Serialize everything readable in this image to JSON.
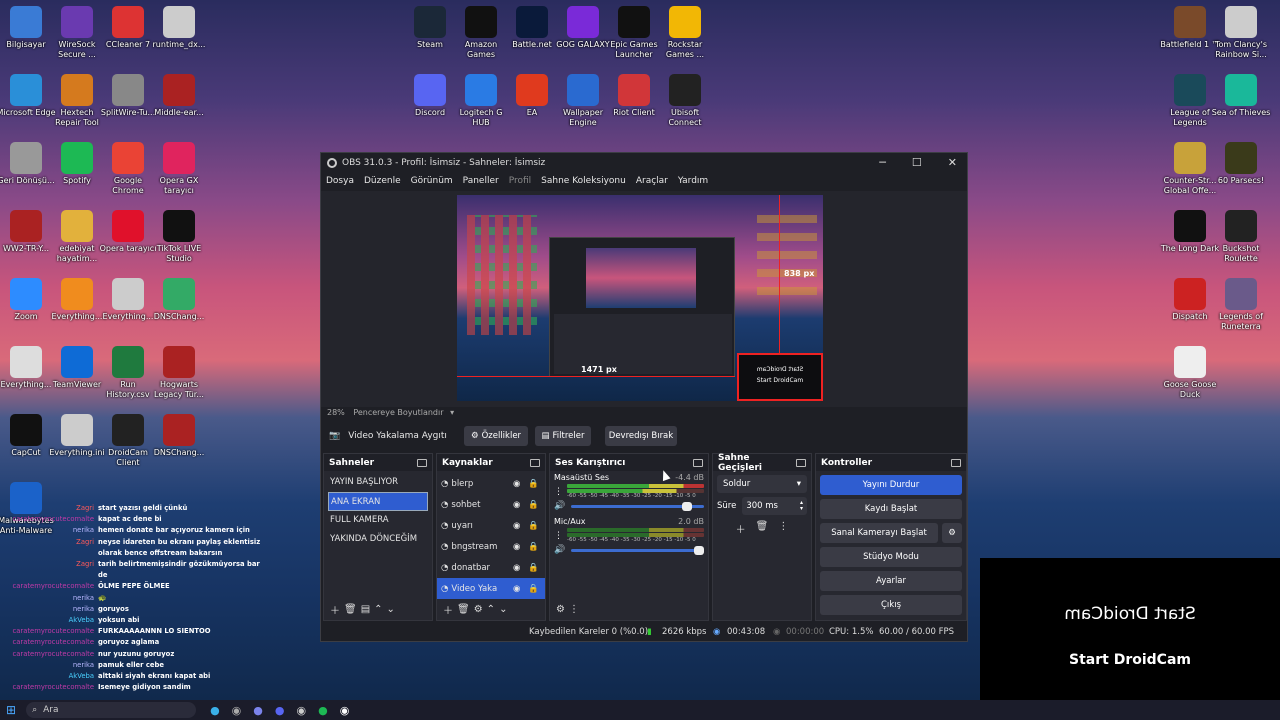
{
  "desktop_left": [
    {
      "label": "Bilgisayar",
      "color": "#3a7bd5"
    },
    {
      "label": "WireSock Secure ...",
      "color": "#6a3ab0"
    },
    {
      "label": "CCleaner 7",
      "color": "#d33"
    },
    {
      "label": "runtime_dx...",
      "color": "#ccc"
    },
    {
      "label": "Microsoft Edge",
      "color": "#2a8fd8"
    },
    {
      "label": "Hextech Repair Tool",
      "color": "#d57a1e"
    },
    {
      "label": "SplitWire-Tu...",
      "color": "#888"
    },
    {
      "label": "Middle-ear...",
      "color": "#a22"
    },
    {
      "label": "Geri Dönüşü...",
      "color": "#999"
    },
    {
      "label": "Spotify",
      "color": "#1db954"
    },
    {
      "label": "Google Chrome",
      "color": "#ea4335"
    },
    {
      "label": "Opera GX tarayıcı",
      "color": "#e0245e"
    },
    {
      "label": "WW2-TR-Y...",
      "color": "#a22"
    },
    {
      "label": "edebiyat hayatim...",
      "color": "#e2b13c"
    },
    {
      "label": "Opera tarayıcı",
      "color": "#e0112b"
    },
    {
      "label": "TikTok LIVE Studio",
      "color": "#111"
    },
    {
      "label": "Zoom",
      "color": "#2d8cff"
    },
    {
      "label": "Everything...",
      "color": "#f08c1e"
    },
    {
      "label": "Everything...",
      "color": "#ccc"
    },
    {
      "label": "DNSChang...",
      "color": "#3a6"
    },
    {
      "label": "Everything...",
      "color": "#ddd"
    },
    {
      "label": "TeamViewer",
      "color": "#0e6bd6"
    },
    {
      "label": "Run History.csv",
      "color": "#1f7a3e"
    },
    {
      "label": "Hogwarts Legacy Tür...",
      "color": "#a22"
    },
    {
      "label": "CapCut",
      "color": "#111"
    },
    {
      "label": "Everything.ini",
      "color": "#ccc"
    },
    {
      "label": "DroidCam Client",
      "color": "#222"
    },
    {
      "label": "DNSChang...",
      "color": "#a22"
    },
    {
      "label": "Malwarebytes Anti-Malware",
      "color": "#1b62c9"
    }
  ],
  "desktop_top": [
    {
      "label": "Steam",
      "color": "#1b2838"
    },
    {
      "label": "Amazon Games",
      "color": "#111"
    },
    {
      "label": "Battle.net",
      "color": "#0a1a3a"
    },
    {
      "label": "GOG GALAXY",
      "color": "#7a2ad8"
    },
    {
      "label": "Epic Games Launcher",
      "color": "#111"
    },
    {
      "label": "Rockstar Games ...",
      "color": "#f2b705"
    },
    {
      "label": "Discord",
      "color": "#5865f2"
    },
    {
      "label": "Logitech G HUB",
      "color": "#2a7be4"
    },
    {
      "label": "EA",
      "color": "#e03a1e"
    },
    {
      "label": "Wallpaper Engine",
      "color": "#2a6ad0"
    },
    {
      "label": "Riot Client",
      "color": "#d13639"
    },
    {
      "label": "Ubisoft Connect",
      "color": "#222"
    }
  ],
  "desktop_right": [
    {
      "label": "Battlefield 1 ™",
      "color": "#7a4a2a"
    },
    {
      "label": "Tom Clancy's Rainbow Si...",
      "color": "#ccc"
    },
    {
      "label": "League of Legends",
      "color": "#1a4a5a"
    },
    {
      "label": "Sea of Thieves",
      "color": "#1ab89a"
    },
    {
      "label": "Counter-Str... Global Offe...",
      "color": "#c8a23a"
    },
    {
      "label": "60 Parsecs!",
      "color": "#3a3a1a"
    },
    {
      "label": "The Long Dark",
      "color": "#111"
    },
    {
      "label": "Buckshot Roulette",
      "color": "#222"
    },
    {
      "label": "Dispatch",
      "color": "#c22"
    },
    {
      "label": "Legends of Runeterra",
      "color": "#6a5a8a"
    },
    {
      "label": "Goose Goose Duck",
      "color": "#eee"
    }
  ],
  "obs": {
    "title": "OBS 31.0.3 - Profil: İsimsiz - Sahneler: İsimsiz",
    "menu": [
      "Dosya",
      "Düzenle",
      "Görünüm",
      "Paneller",
      "Profil",
      "Sahne Koleksiyonu",
      "Araçlar",
      "Yardım"
    ],
    "zoom": "28%",
    "zoom_mode": "Pencereye Boyutlandır",
    "px_h": "1471 px",
    "px_v": "838 px",
    "droidcam_small_mirror": "Start DroidCam",
    "droidcam_small": "Start DroidCam",
    "source_name": "Video Yakalama Aygıtı",
    "btn_props": "Özellikler",
    "btn_filters": "Filtreler",
    "btn_deactivate": "Devredışı Bırak",
    "scenes_title": "Sahneler",
    "scenes": [
      "YAYIN BAŞLIYOR",
      "ANA EKRAN",
      "FULL KAMERA",
      "YAKINDA DÖNCEĞİM"
    ],
    "sources_title": "Kaynaklar",
    "sources": [
      "blerp",
      "sohbet",
      "uyarı",
      "bngstream",
      "donatbar",
      "Video Yaka"
    ],
    "mixer_title": "Ses Karıştırıcı",
    "mix1_name": "Masaüstü Ses",
    "mix1_db": "-4.4 dB",
    "mix2_name": "Mic/Aux",
    "mix2_db": "2.0 dB",
    "meter_scale": "-60 -55 -50 -45 -40 -35 -30 -25 -20 -15 -10 -5 0",
    "trans_title": "Sahne Geçişleri",
    "trans_value": "Soldur",
    "trans_dur_label": "Süre",
    "trans_dur": "300 ms",
    "controls_title": "Kontroller",
    "controls": [
      "Yayını Durdur",
      "Kaydı Başlat",
      "Sanal Kamerayı Başlat",
      "Stüdyo Modu",
      "Ayarlar",
      "Çıkış"
    ],
    "status_dropped": "Kaybedilen Kareler 0 (%0.0)",
    "status_kbps": "2626 kbps",
    "status_time1": "00:43:08",
    "status_time2": "00:00:00",
    "status_cpu": "CPU: 1.5%",
    "status_fps": "60.00 / 60.00 FPS"
  },
  "droidcam_panel": {
    "mirror": "Start DroidCam",
    "label": "Start DroidCam"
  },
  "chat": [
    {
      "name": "Zagri",
      "color": "#ff5a5a",
      "msg": "start yazısı geldi çünkü"
    },
    {
      "name": "caratemyrocutecomalte",
      "color": "#c23aa8",
      "msg": "kapat ac dene bi"
    },
    {
      "name": "nerika",
      "color": "#b7b7ff",
      "msg": "hemen donate bar açıyoruz kamera için"
    },
    {
      "name": "Zagri",
      "color": "#ff5a5a",
      "msg": "neyse idareten bu ekranı paylaş eklentisiz"
    },
    {
      "name": "",
      "color": "#fff",
      "msg": "olarak bence offstream bakarsın"
    },
    {
      "name": "Zagri",
      "color": "#ff5a5a",
      "msg": "tarih belirtmemişsindir gözükmüyorsa bar için"
    },
    {
      "name": "",
      "color": "#fff",
      "msg": "de"
    },
    {
      "name": "caratemyrocutecomalte",
      "color": "#c23aa8",
      "msg": "ÖLME PEPE ÖLMEE"
    },
    {
      "name": "nerika",
      "color": "#b7b7ff",
      "msg": "🐢"
    },
    {
      "name": "nerika",
      "color": "#b7b7ff",
      "msg": "goruyos"
    },
    {
      "name": "AkVeba",
      "color": "#4ad1ff",
      "msg": "yoksun abi"
    },
    {
      "name": "caratemyrocutecomalte",
      "color": "#c23aa8",
      "msg": "FURKAAAAANNN LO SIENTOO"
    },
    {
      "name": "caratemyrocutecomalte",
      "color": "#c23aa8",
      "msg": "goruyoz aglama"
    },
    {
      "name": "caratemyrocutecomalte",
      "color": "#c23aa8",
      "msg": "nur yuzunu goruyoz"
    },
    {
      "name": "nerika",
      "color": "#b7b7ff",
      "msg": "pamuk eller cebe"
    },
    {
      "name": "AkVeba",
      "color": "#4ad1ff",
      "msg": "alttaki siyah ekranı kapat abi"
    },
    {
      "name": "caratemyrocutecomalte",
      "color": "#c23aa8",
      "msg": "Isemeye gidiyon sandim"
    }
  ],
  "taskbar": {
    "search": "Ara"
  }
}
